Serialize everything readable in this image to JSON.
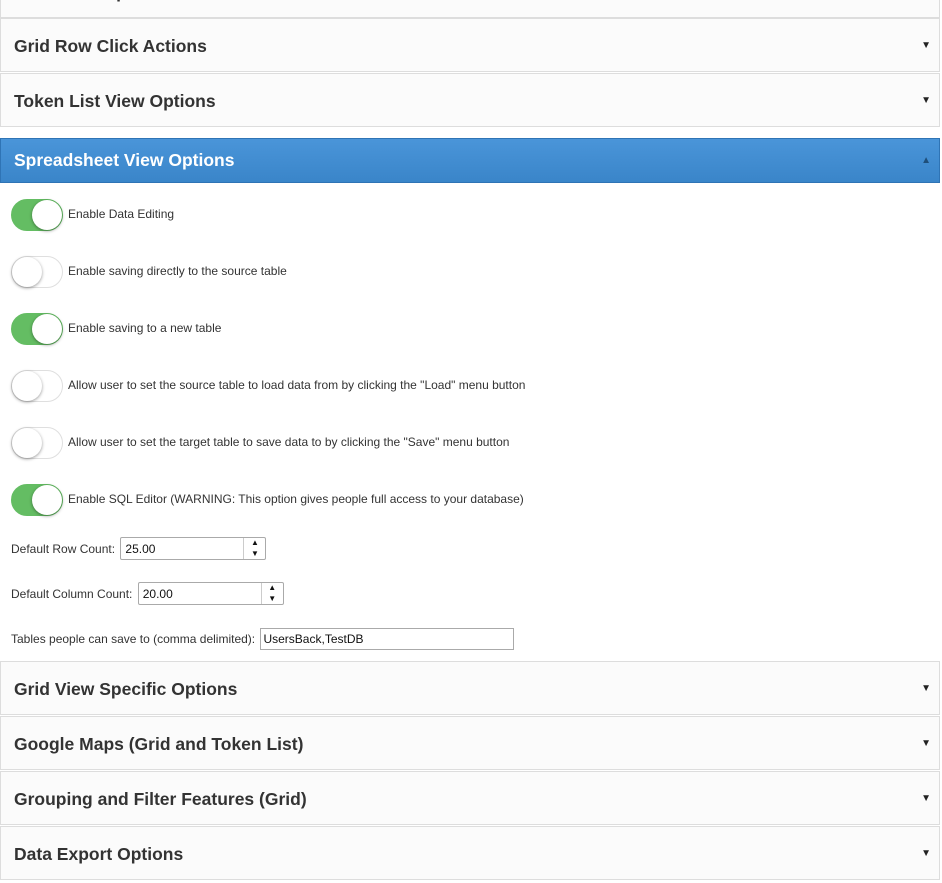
{
  "panels_above": [
    {
      "title": "Advanced Options",
      "arrow": "▼"
    },
    {
      "title": "Grid Row Click Actions",
      "arrow": "▼"
    },
    {
      "title": "Token List View Options",
      "arrow": "▼"
    }
  ],
  "active_panel": {
    "title": "Spreadsheet View Options",
    "arrow": "▲",
    "toggles": [
      {
        "label": "Enable Data Editing",
        "on": true
      },
      {
        "label": "Enable saving directly to the source table",
        "on": false
      },
      {
        "label": "Enable saving to a new table",
        "on": true
      },
      {
        "label": "Allow user to set the source table to load data from by clicking the \"Load\" menu button",
        "on": false
      },
      {
        "label": "Allow user to set the target table to save data to by clicking the \"Save\" menu button",
        "on": false
      },
      {
        "label": "Enable SQL Editor (WARNING: This option gives people full access to your database)",
        "on": true
      }
    ],
    "default_row_count": {
      "label": "Default Row Count:",
      "value": "25.00",
      "up": "▲",
      "down": "▼"
    },
    "default_column_count": {
      "label": "Default Column Count:",
      "value": "20.00",
      "up": "▲",
      "down": "▼"
    },
    "save_tables": {
      "label": "Tables people can save to (comma delimited):",
      "value": "UsersBack,TestDB"
    }
  },
  "panels_below": [
    {
      "title": "Grid View Specific Options",
      "arrow": "▼"
    },
    {
      "title": "Google Maps (Grid and Token List)",
      "arrow": "▼"
    },
    {
      "title": "Grouping and Filter Features (Grid)",
      "arrow": "▼"
    },
    {
      "title": "Data Export Options",
      "arrow": "▼"
    }
  ],
  "colors": {
    "active_header": "#3f8bd0",
    "switch_on": "#64bd63",
    "switch_off": "#ffffff"
  }
}
